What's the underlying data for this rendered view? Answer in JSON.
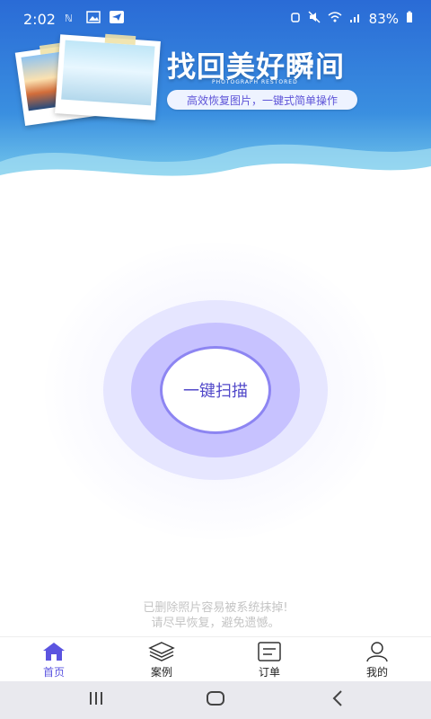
{
  "status": {
    "time": "2:02",
    "battery": "83%"
  },
  "header": {
    "title": "找回美好瞬间",
    "subtitle_en": "PHOTOGRAPH RESTORED",
    "tagline": "高效恢复图片，一键式简单操作"
  },
  "scan": {
    "button_label": "一键扫描"
  },
  "tip": {
    "line1": "已删除照片容易被系统抹掉!",
    "line2": "请尽早恢复，避免遗憾。"
  },
  "nav": {
    "items": [
      {
        "label": "首页",
        "icon": "home-icon",
        "active": true
      },
      {
        "label": "案例",
        "icon": "layers-icon",
        "active": false
      },
      {
        "label": "订单",
        "icon": "order-icon",
        "active": false
      },
      {
        "label": "我的",
        "icon": "user-icon",
        "active": false
      }
    ]
  },
  "colors": {
    "accent": "#5b54e0",
    "header_top": "#2a6bd6",
    "ring_inner": "#c7c2ff"
  }
}
